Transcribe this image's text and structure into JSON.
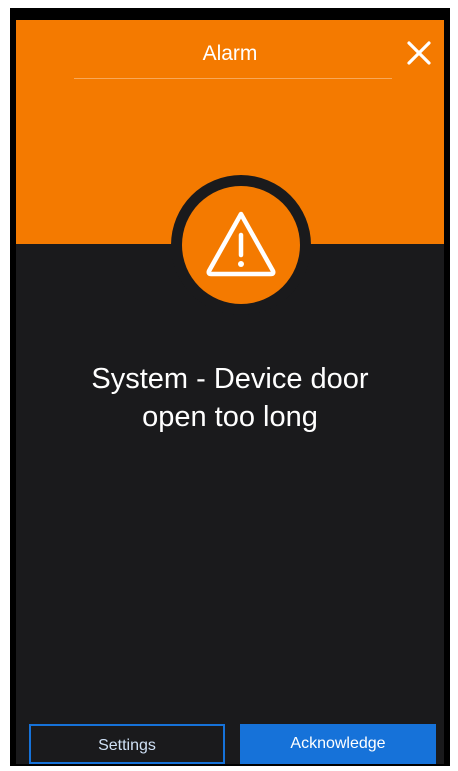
{
  "dialog": {
    "title": "Alarm",
    "message_line1": "System - Device door",
    "message_line2": "open too long"
  },
  "buttons": {
    "settings_label": "Settings",
    "acknowledge_label": "Acknowledge"
  },
  "icons": {
    "close": "close-icon",
    "alert": "warning-triangle-icon"
  },
  "colors": {
    "header_orange": "#f47a00",
    "panel_dark": "#1a1a1c",
    "button_blue": "#1672d9"
  }
}
